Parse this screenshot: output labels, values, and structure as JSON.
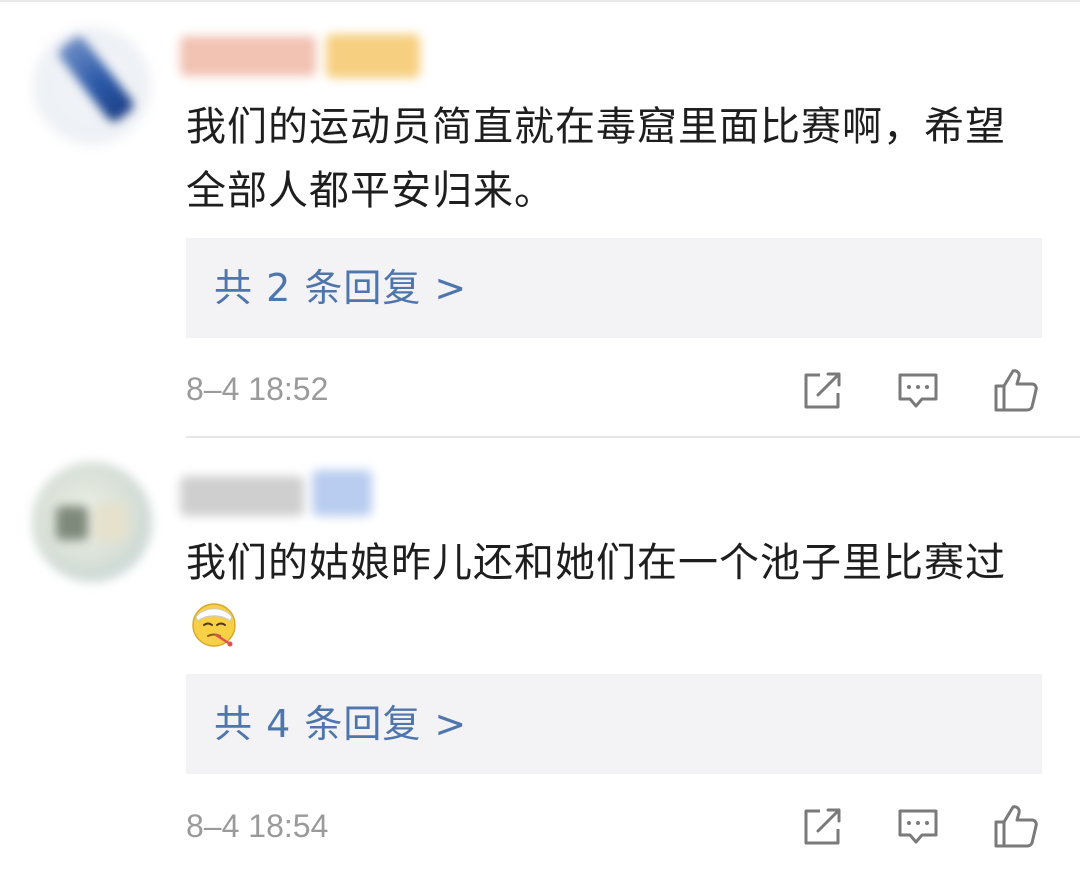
{
  "comments": [
    {
      "text": "我们的运动员简直就在毒窟里面比赛啊，希望全部人都平安归来。",
      "replies_label": "共 2 条回复 >",
      "timestamp": "8–4 18:52"
    },
    {
      "text": "我们的姑娘昨儿还和她们在一个池子里比赛过",
      "emoji": "sick-face-emoji",
      "replies_label": "共 4 条回复 >",
      "timestamp": "8–4 18:54"
    }
  ],
  "icons": {
    "share": "share-icon",
    "reply": "comment-icon",
    "like": "thumbs-up-icon"
  },
  "colors": {
    "link": "#4f75ad",
    "reply_box_bg": "#f3f3f5",
    "timestamp": "#9a9a9a",
    "text": "#1e1e1e",
    "icon": "#7a7a7a"
  }
}
